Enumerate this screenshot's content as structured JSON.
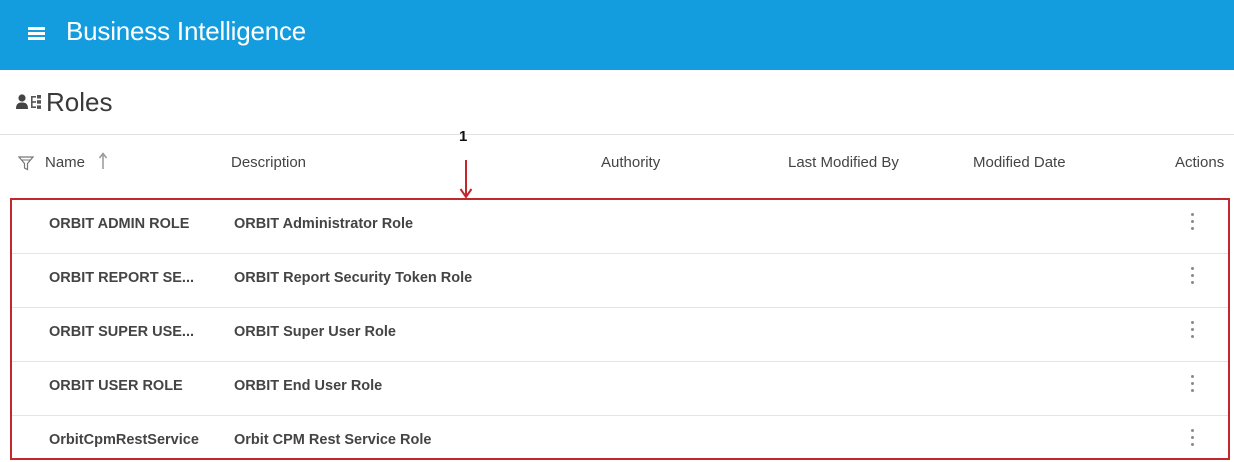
{
  "header": {
    "app_title": "Business Intelligence",
    "menu_icon": "hamburger-menu-icon"
  },
  "page": {
    "title": "Roles",
    "icon": "user-roles-icon"
  },
  "annotation": {
    "number": "1",
    "color": "#c0282d"
  },
  "table": {
    "columns": {
      "name": "Name",
      "description": "Description",
      "authority": "Authority",
      "last_modified_by": "Last Modified By",
      "modified_date": "Modified Date",
      "actions": "Actions"
    },
    "sort": {
      "column": "Name",
      "direction": "ascending",
      "icon": "arrow-up-icon"
    },
    "filter_icon": "filter-icon",
    "rows": [
      {
        "name": "ORBIT ADMIN ROLE",
        "description": "ORBIT Administrator Role"
      },
      {
        "name": "ORBIT REPORT SE...",
        "description": "ORBIT Report Security Token Role"
      },
      {
        "name": "ORBIT SUPER USE...",
        "description": "ORBIT Super User Role"
      },
      {
        "name": "ORBIT USER ROLE",
        "description": "ORBIT End User Role"
      },
      {
        "name": "OrbitCpmRestService",
        "description": "Orbit CPM Rest Service Role"
      }
    ]
  },
  "colors": {
    "header_bg": "#139ddf",
    "highlight_border": "#c0282d"
  }
}
